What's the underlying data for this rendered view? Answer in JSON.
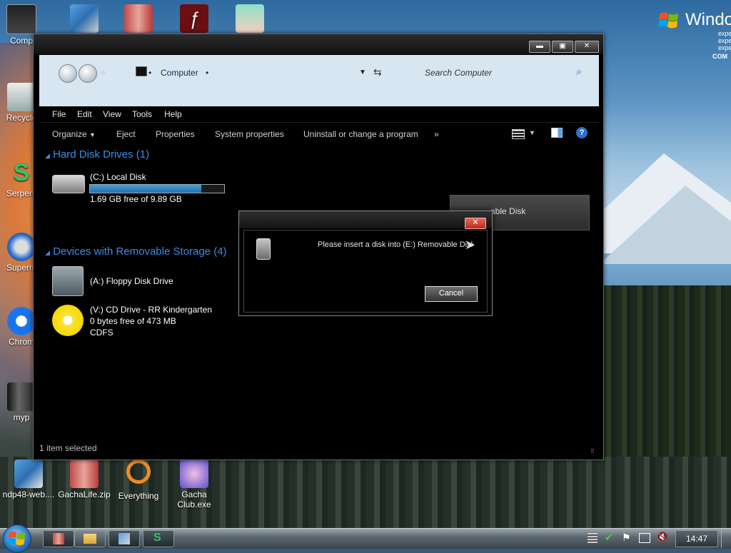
{
  "desktop": {
    "icons": [
      {
        "id": "computer",
        "label": "Comp"
      },
      {
        "id": "net",
        "label": ""
      },
      {
        "id": "zip",
        "label": ""
      },
      {
        "id": "flash",
        "label": ""
      },
      {
        "id": "anime",
        "label": ""
      },
      {
        "id": "recycle",
        "label": "Recycle"
      },
      {
        "id": "serpent",
        "label": "Serpent"
      },
      {
        "id": "superm",
        "label": "Superm"
      },
      {
        "id": "chrome",
        "label": "Chrom"
      },
      {
        "id": "myp",
        "label": "myp"
      },
      {
        "id": "ndp",
        "label": "ndp48-web...."
      },
      {
        "id": "gachalife",
        "label": "GachaLife.zip"
      },
      {
        "id": "everything",
        "label": "Everything"
      },
      {
        "id": "gachaclub",
        "label": "Gacha Club.exe"
      }
    ],
    "windows_logo": {
      "word": "Windo",
      "lines": [
        "expe",
        "expe",
        "expe"
      ],
      "tag": "COM"
    }
  },
  "window": {
    "breadcrumb": "Computer",
    "search_placeholder": "Search Computer",
    "menu": [
      "File",
      "Edit",
      "View",
      "Tools",
      "Help"
    ],
    "toolbar": {
      "organize": "Organize",
      "eject": "Eject",
      "properties": "Properties",
      "system_properties": "System properties",
      "uninstall": "Uninstall or change a program",
      "more": "»"
    },
    "groups": {
      "hdd": "Hard Disk Drives (1)",
      "removable": "Devices with Removable Storage (4)"
    },
    "drives": {
      "c": {
        "name": "(C:) Local Disk",
        "free": "1.69 GB free of 9.89 GB",
        "used_fraction": 0.83
      },
      "a": {
        "name": "(A:) Floppy Disk Drive"
      },
      "v": {
        "name": "(V:) CD Drive - RR Kindergarten",
        "free": "0 bytes free of 473 MB",
        "fs": "CDFS"
      },
      "e_partial": "able Disk"
    },
    "status": "1 item selected"
  },
  "dialog": {
    "message": "Please insert a disk into (E:) Removable Disk",
    "cancel": "Cancel",
    "close": "✕"
  },
  "taskbar": {
    "clock": "14:47"
  }
}
